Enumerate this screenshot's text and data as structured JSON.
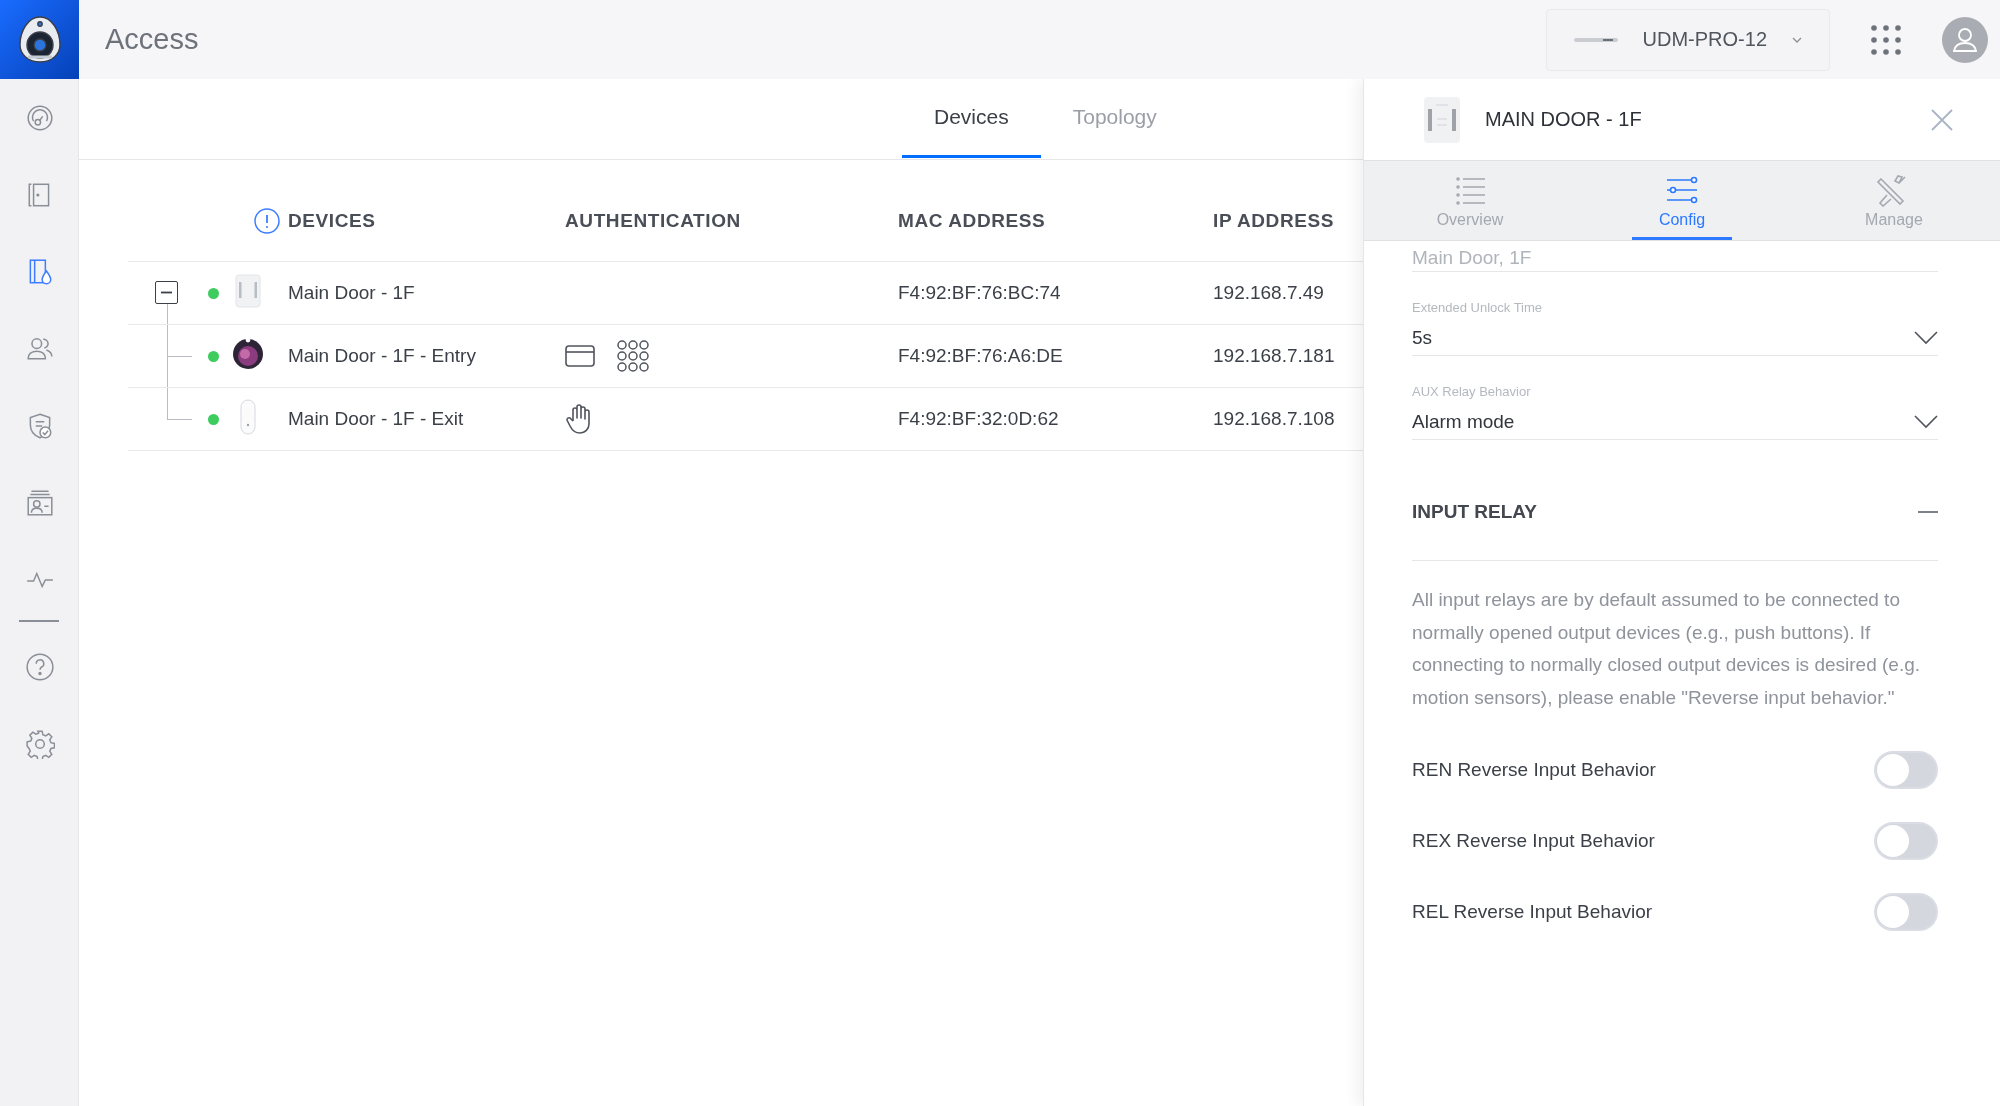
{
  "app": {
    "title": "Access"
  },
  "sidebar": {
    "items": [
      {
        "kind": "dashboard",
        "selected": false
      },
      {
        "kind": "doors",
        "selected": false
      },
      {
        "kind": "devices",
        "selected": true
      },
      {
        "kind": "users",
        "selected": false
      },
      {
        "kind": "policies",
        "selected": false
      },
      {
        "kind": "visitors",
        "selected": false
      },
      {
        "kind": "activity",
        "selected": false
      }
    ],
    "bottom_items": [
      {
        "kind": "help",
        "selected": false
      },
      {
        "kind": "settings",
        "selected": false
      }
    ]
  },
  "header": {
    "device_selector": {
      "label": "UDM-PRO-12"
    }
  },
  "tabs": [
    {
      "label": "Devices",
      "selected": true
    },
    {
      "label": "Topology",
      "selected": false
    }
  ],
  "table": {
    "columns": [
      "DEVICES",
      "AUTHENTICATION",
      "MAC ADDRESS",
      "IP ADDRESS"
    ],
    "rows": [
      {
        "name": "Main Door - 1F",
        "device": {
          "kind": "hub"
        },
        "online": true,
        "expanded": true,
        "mac": "F4:92:BF:76:BC:74",
        "ip": "192.168.7.49",
        "children": [
          {
            "name": "Main Door - 1F - Entry",
            "device": {
              "kind": "reader"
            },
            "online": true,
            "auth": [
              {
                "kind": "card"
              },
              {
                "kind": "pin"
              }
            ],
            "mac": "F4:92:BF:76:A6:DE",
            "ip": "192.168.7.181"
          },
          {
            "name": "Main Door - 1F - Exit",
            "device": {
              "kind": "exit"
            },
            "online": true,
            "auth": [
              {
                "kind": "touch"
              }
            ],
            "mac": "F4:92:BF:32:0D:62",
            "ip": "192.168.7.108"
          }
        ]
      }
    ]
  },
  "panel": {
    "title": "MAIN DOOR - 1F",
    "tabs": [
      {
        "label": "Overview",
        "kind": "list",
        "selected": false
      },
      {
        "label": "Config",
        "kind": "sliders",
        "selected": true
      },
      {
        "label": "Manage",
        "kind": "tools",
        "selected": false
      }
    ],
    "fields": [
      {
        "kind": "text",
        "value": "Main Door, 1F"
      },
      {
        "kind": "dropdown",
        "label": "Extended Unlock Time",
        "value": "5s"
      },
      {
        "kind": "dropdown",
        "label": "AUX Relay Behavior",
        "value": "Alarm mode"
      }
    ],
    "section": {
      "title": "INPUT RELAY",
      "expanded": true,
      "description": "All input relays are by default assumed to be connected to normally opened output devices (e.g., push buttons). If connecting to normally closed output devices is desired (e.g. motion sensors), please enable \"Reverse input behavior.\"",
      "toggles": [
        {
          "label": "REN Reverse Input Behavior",
          "on": false
        },
        {
          "label": "REX Reverse Input Behavior",
          "on": false
        },
        {
          "label": "REL Reverse Input Behavior",
          "on": false
        }
      ]
    }
  }
}
